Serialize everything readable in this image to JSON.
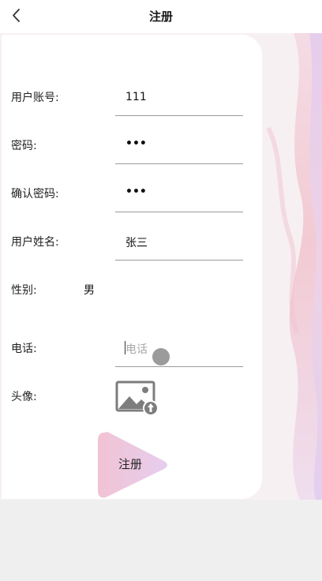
{
  "header": {
    "title": "注册",
    "back_icon": "chevron-left-icon"
  },
  "form": {
    "account": {
      "label": "用户账号:",
      "value": "111"
    },
    "password": {
      "label": "密码:",
      "value": "•••"
    },
    "confirm_password": {
      "label": "确认密码:",
      "value": "•••"
    },
    "name": {
      "label": "用户姓名:",
      "value": "张三"
    },
    "gender": {
      "label": "性别:",
      "value": "男"
    },
    "phone": {
      "label": "电话:",
      "placeholder": "电话"
    },
    "avatar": {
      "label": "头像:",
      "icon": "image-upload-icon"
    }
  },
  "submit": {
    "label": "注册"
  },
  "colors": {
    "card": "#ffffff",
    "background": "#f7f0f2",
    "accent_pink": "#f1c9d6",
    "accent_lavender": "#e7cdef",
    "underline": "#9a9a9a"
  }
}
